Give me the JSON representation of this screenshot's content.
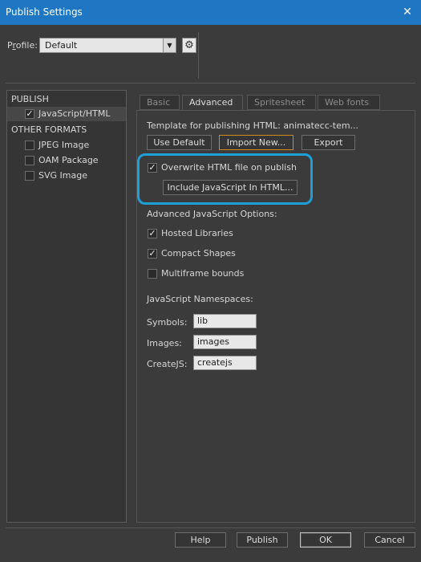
{
  "window": {
    "title": "Publish Settings",
    "close_glyph": "✕"
  },
  "profile": {
    "label_prefix": "P",
    "label_underlined": "r",
    "label_suffix": "ofile:",
    "value": "Default"
  },
  "left_panel": {
    "publish_header": "PUBLISH",
    "publish_items": [
      {
        "label": "JavaScript/HTML",
        "checked": true
      }
    ],
    "other_header": "OTHER FORMATS",
    "other_items": [
      {
        "label": "JPEG Image",
        "checked": false
      },
      {
        "label": "OAM Package",
        "checked": false
      },
      {
        "label": "SVG Image",
        "checked": false
      }
    ]
  },
  "tabs": [
    "Basic",
    "Advanced",
    "Spritesheet",
    "Web fonts"
  ],
  "active_tab": "Advanced",
  "template": {
    "label": "Template for publishing HTML:  animatecc-tem...",
    "use_default": "Use Default",
    "import_new": "Import New...",
    "export": "Export"
  },
  "overwrite": {
    "label": "Overwrite HTML file on publish",
    "checked": true
  },
  "include_js_button": "Include JavaScript In HTML...",
  "advanced_js": {
    "header": "Advanced JavaScript Options:",
    "options": [
      {
        "label": "Hosted Libraries",
        "checked": true
      },
      {
        "label": "Compact Shapes",
        "checked": true
      },
      {
        "label": "Multiframe bounds",
        "checked": false
      }
    ]
  },
  "namespaces": {
    "header": "JavaScript Namespaces:",
    "fields": [
      {
        "label": "Symbols:",
        "value": "lib"
      },
      {
        "label": "Images:",
        "value": "images"
      },
      {
        "label": "CreateJS:",
        "value": "createjs"
      }
    ]
  },
  "footer": {
    "help": "Help",
    "publish": "Publish",
    "ok": "OK",
    "cancel": "Cancel"
  },
  "colors": {
    "titlebar": "#1f76c3",
    "highlight_ring": "#1e9fd6",
    "focus_border": "#d08a1e",
    "background": "#3b3b3b"
  }
}
